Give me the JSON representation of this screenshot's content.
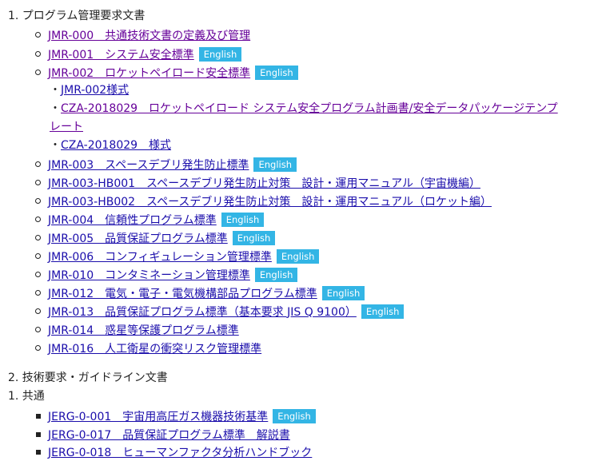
{
  "section1": {
    "heading": "1. プログラム管理要求文書",
    "items": [
      {
        "label": "JMR-000　共通技術文書の定義及び管理",
        "badge": ""
      },
      {
        "label": "JMR-001　システム安全標準",
        "badge": "English"
      },
      {
        "label": "JMR-002　ロケットペイロード安全標準",
        "badge": "English"
      }
    ],
    "sub_items": [
      {
        "bullet": "・",
        "label": "JMR-002様式"
      },
      {
        "bullet": "・",
        "label": "CZA-2018029　ロケットペイロード システム安全プログラム計画書/安全データパッケージテンプ",
        "label_cont": "レート"
      },
      {
        "bullet": "・",
        "label": "CZA-2018029　様式"
      }
    ],
    "items2": [
      {
        "label": "JMR-003　スペースデブリ発生防止標準",
        "badge": "English"
      },
      {
        "label": "JMR-003-HB001　スペースデブリ発生防止対策　設計・運用マニュアル（宇宙機編）",
        "badge": ""
      },
      {
        "label": "JMR-003-HB002　スペースデブリ発生防止対策　設計・運用マニュアル（ロケット編）",
        "badge": ""
      },
      {
        "label": "JMR-004　信頼性プログラム標準",
        "badge": "English"
      },
      {
        "label": "JMR-005　品質保証プログラム標準",
        "badge": "English"
      },
      {
        "label": "JMR-006　コンフィギュレーション管理標準",
        "badge": "English"
      },
      {
        "label": "JMR-010　コンタミネーション管理標準",
        "badge": "English"
      },
      {
        "label": "JMR-012　電気・電子・電気機構部品プログラム標準",
        "badge": "English"
      },
      {
        "label": "JMR-013　品質保証プログラム標準（基本要求 JIS Q 9100）",
        "badge": "English"
      },
      {
        "label": "JMR-014　惑星等保護プログラム標準",
        "badge": ""
      },
      {
        "label": "JMR-016　人工衛星の衝突リスク管理標準",
        "badge": ""
      }
    ]
  },
  "section2": {
    "heading": "2. 技術要求・ガイドライン文書",
    "subheading": "1. 共通",
    "items": [
      {
        "label": "JERG-0-001　宇宙用高圧ガス機器技術基準",
        "badge": "English"
      },
      {
        "label": "JERG-0-017　品質保証プログラム標準　解説書",
        "badge": ""
      },
      {
        "label": "JERG-0-018　ヒューマンファクタ分析ハンドブック",
        "badge": ""
      }
    ]
  },
  "colors": {
    "link": "#1a0dab",
    "visited_link": "#660099",
    "badge_bg": "#33b5e5",
    "badge_text": "#ffffff",
    "text": "#222222"
  }
}
